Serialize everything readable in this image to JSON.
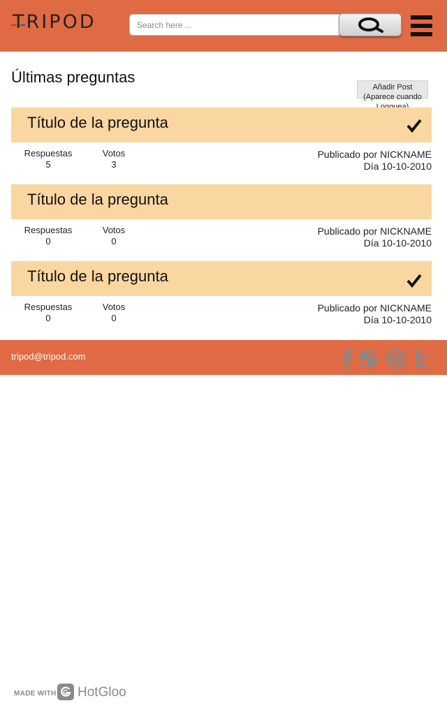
{
  "header": {
    "logo_text": "TRIPOD",
    "logo_colors": [
      "#ff2020",
      "#22aa22",
      "#2244ff"
    ],
    "search": {
      "placeholder": "Search here ...",
      "value": ""
    },
    "search_button_icon": "search-icon",
    "menu_icon": "hamburger-menu-icon",
    "background": "#e06a44"
  },
  "main": {
    "title": "Últimas preguntas",
    "add_post_label": "Añadir Post (Aparece cuando Logguea)",
    "questions": [
      {
        "title": "Título de la pregunta",
        "answered": true,
        "answers_label": "Respuestas",
        "answers": "5",
        "votes_label": "Votos",
        "votes": "3",
        "posted_by": "Publicado por NICKNAME",
        "date": "Día 10-10-2010"
      },
      {
        "title": "Título de la pregunta",
        "answered": false,
        "answers_label": "Respuestas",
        "answers": "0",
        "votes_label": "Votos",
        "votes": "0",
        "posted_by": "Publicado por NICKNAME",
        "date": "Día 10-10-2010"
      },
      {
        "title": "Título de la pregunta",
        "answered": true,
        "answers_label": "Respuestas",
        "answers": "0",
        "votes_label": "Votos",
        "votes": "0",
        "posted_by": "Publicado por NICKNAME",
        "date": "Día 10-10-2010"
      }
    ],
    "question_bar_color": "#fad7a1"
  },
  "footer": {
    "email": "tripod@tripod.com",
    "social_icons": [
      "facebook-icon",
      "picasa-icon",
      "dribbble-icon",
      "tumblr-icon"
    ]
  },
  "badge": {
    "made_with": "MADE WITH",
    "brand": "HotGloo"
  }
}
